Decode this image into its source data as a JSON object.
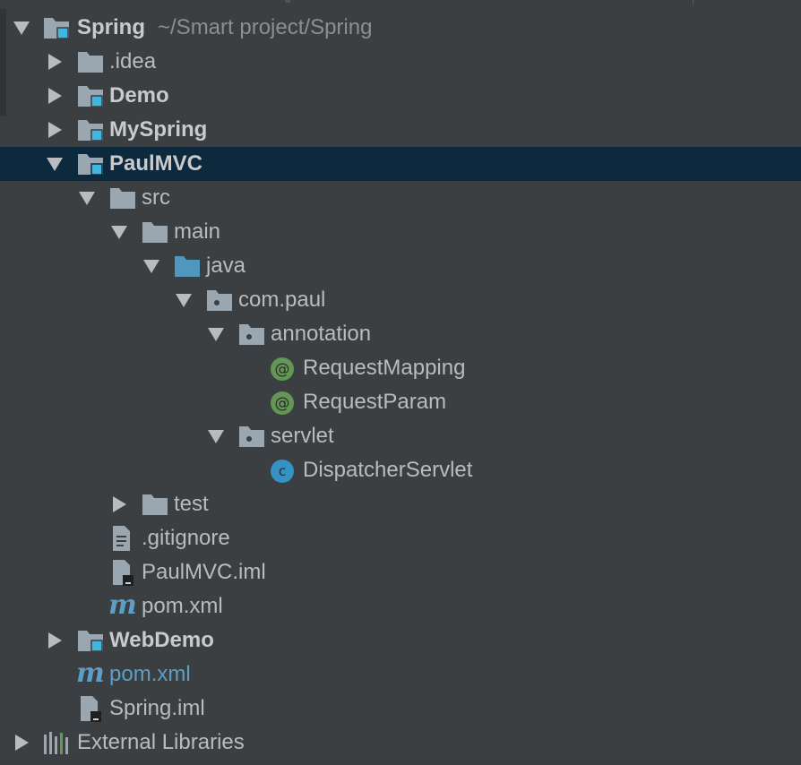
{
  "tree": {
    "items": [
      {
        "label": "Spring",
        "path": "~/Smart project/Spring",
        "icon": "module-folder-icon"
      },
      {
        "label": ".idea",
        "icon": "folder-icon"
      },
      {
        "label": "Demo",
        "icon": "module-folder-icon"
      },
      {
        "label": "MySpring",
        "icon": "module-folder-icon"
      },
      {
        "label": "PaulMVC",
        "icon": "module-folder-icon"
      },
      {
        "label": "src",
        "icon": "folder-icon"
      },
      {
        "label": "main",
        "icon": "folder-icon"
      },
      {
        "label": "java",
        "icon": "source-root-folder-icon"
      },
      {
        "label": "com.paul",
        "icon": "package-icon"
      },
      {
        "label": "annotation",
        "icon": "package-icon"
      },
      {
        "label": "RequestMapping",
        "icon": "annotation-icon"
      },
      {
        "label": "RequestParam",
        "icon": "annotation-icon"
      },
      {
        "label": "servlet",
        "icon": "package-icon"
      },
      {
        "label": "DispatcherServlet",
        "icon": "class-icon"
      },
      {
        "label": "test",
        "icon": "folder-icon"
      },
      {
        "label": ".gitignore",
        "icon": "text-file-icon"
      },
      {
        "label": "PaulMVC.iml",
        "icon": "iml-file-icon"
      },
      {
        "label": "pom.xml",
        "icon": "maven-icon"
      },
      {
        "label": "WebDemo",
        "icon": "module-folder-icon"
      },
      {
        "label": "pom.xml",
        "icon": "maven-icon"
      },
      {
        "label": "Spring.iml",
        "icon": "iml-file-icon"
      },
      {
        "label": "External Libraries",
        "icon": "libraries-icon"
      }
    ]
  },
  "colors": {
    "background": "#3c3f41",
    "selection": "#0d293e",
    "text": "#bbbbbb",
    "folder": "#9aa7b0",
    "module_badge": "#40b6e0",
    "source_root": "#4f97bd",
    "annotation": "#629755",
    "class": "#3592c4",
    "maven": "#5d9ec7"
  }
}
